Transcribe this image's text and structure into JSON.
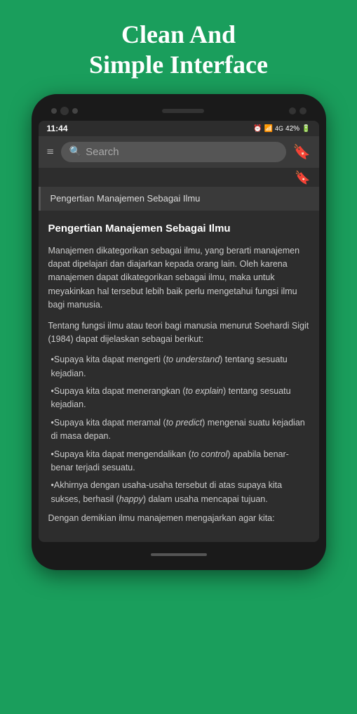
{
  "header": {
    "title_line1": "Clean And",
    "title_line2": "Simple Interface"
  },
  "status_bar": {
    "time": "11:44",
    "battery": "42%"
  },
  "toolbar": {
    "search_placeholder": "Search",
    "menu_icon": "≡",
    "bookmark_icon": "🔖"
  },
  "breadcrumb": {
    "text": "Pengertian Manajemen Sebagai Ilmu"
  },
  "article": {
    "title": "Pengertian Manajemen Sebagai Ilmu",
    "paragraphs": [
      "Manajemen dikategorikan sebagai ilmu, yang berarti manajemen dapat dipelajari dan diajarkan kepada orang lain. Oleh karena manajemen dapat dikategorikan sebagai ilmu, maka untuk meyakinkan hal tersebut lebih baik perlu mengetahui fungsi ilmu bagi manusia.",
      "Tentang fungsi ilmu atau teori bagi manusia menurut Soehardi Sigit (1984) dapat dijelaskan sebagai berikut:"
    ],
    "bullets": [
      "•Supaya kita dapat mengerti (to understand) tentang sesuatu kejadian.",
      "•Supaya kita dapat menerangkan (to explain) tentang sesuatu kejadian.",
      "•Supaya kita dapat meramal (to predict) mengenai suatu kejadian di masa depan.",
      "•Supaya kita dapat mengendalikan (to control) apabila benar-benar terjadi sesuatu.",
      "•Akhirnya dengan usaha-usaha tersebut di atas supaya kita sukses, berhasil (happy) dalam usaha mencapai tujuan."
    ],
    "closing": "Dengan demikian ilmu manajemen mengajarkan agar kita:"
  }
}
